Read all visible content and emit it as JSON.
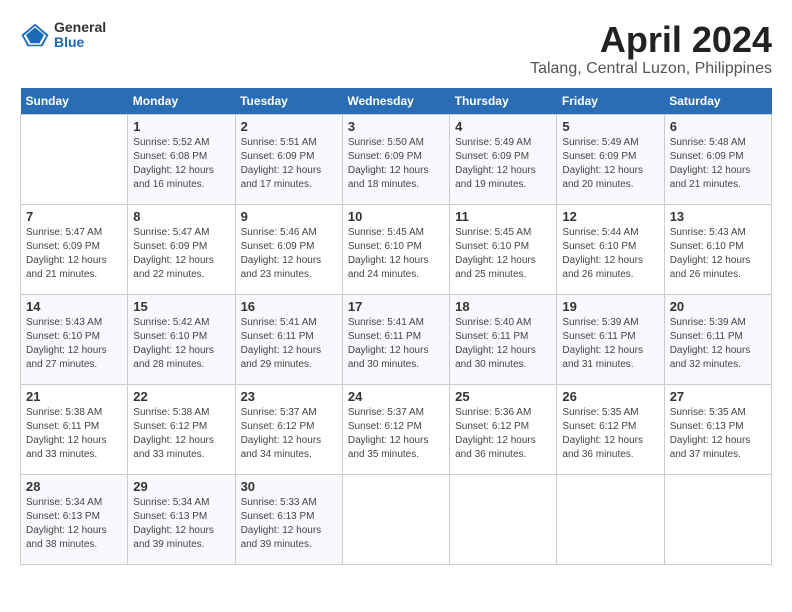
{
  "logo": {
    "general": "General",
    "blue": "Blue"
  },
  "title": "April 2024",
  "location": "Talang, Central Luzon, Philippines",
  "days_of_week": [
    "Sunday",
    "Monday",
    "Tuesday",
    "Wednesday",
    "Thursday",
    "Friday",
    "Saturday"
  ],
  "weeks": [
    [
      {
        "day": "",
        "info": ""
      },
      {
        "day": "1",
        "info": "Sunrise: 5:52 AM\nSunset: 6:08 PM\nDaylight: 12 hours\nand 16 minutes."
      },
      {
        "day": "2",
        "info": "Sunrise: 5:51 AM\nSunset: 6:09 PM\nDaylight: 12 hours\nand 17 minutes."
      },
      {
        "day": "3",
        "info": "Sunrise: 5:50 AM\nSunset: 6:09 PM\nDaylight: 12 hours\nand 18 minutes."
      },
      {
        "day": "4",
        "info": "Sunrise: 5:49 AM\nSunset: 6:09 PM\nDaylight: 12 hours\nand 19 minutes."
      },
      {
        "day": "5",
        "info": "Sunrise: 5:49 AM\nSunset: 6:09 PM\nDaylight: 12 hours\nand 20 minutes."
      },
      {
        "day": "6",
        "info": "Sunrise: 5:48 AM\nSunset: 6:09 PM\nDaylight: 12 hours\nand 21 minutes."
      }
    ],
    [
      {
        "day": "7",
        "info": "Sunrise: 5:47 AM\nSunset: 6:09 PM\nDaylight: 12 hours\nand 21 minutes."
      },
      {
        "day": "8",
        "info": "Sunrise: 5:47 AM\nSunset: 6:09 PM\nDaylight: 12 hours\nand 22 minutes."
      },
      {
        "day": "9",
        "info": "Sunrise: 5:46 AM\nSunset: 6:09 PM\nDaylight: 12 hours\nand 23 minutes."
      },
      {
        "day": "10",
        "info": "Sunrise: 5:45 AM\nSunset: 6:10 PM\nDaylight: 12 hours\nand 24 minutes."
      },
      {
        "day": "11",
        "info": "Sunrise: 5:45 AM\nSunset: 6:10 PM\nDaylight: 12 hours\nand 25 minutes."
      },
      {
        "day": "12",
        "info": "Sunrise: 5:44 AM\nSunset: 6:10 PM\nDaylight: 12 hours\nand 26 minutes."
      },
      {
        "day": "13",
        "info": "Sunrise: 5:43 AM\nSunset: 6:10 PM\nDaylight: 12 hours\nand 26 minutes."
      }
    ],
    [
      {
        "day": "14",
        "info": "Sunrise: 5:43 AM\nSunset: 6:10 PM\nDaylight: 12 hours\nand 27 minutes."
      },
      {
        "day": "15",
        "info": "Sunrise: 5:42 AM\nSunset: 6:10 PM\nDaylight: 12 hours\nand 28 minutes."
      },
      {
        "day": "16",
        "info": "Sunrise: 5:41 AM\nSunset: 6:11 PM\nDaylight: 12 hours\nand 29 minutes."
      },
      {
        "day": "17",
        "info": "Sunrise: 5:41 AM\nSunset: 6:11 PM\nDaylight: 12 hours\nand 30 minutes."
      },
      {
        "day": "18",
        "info": "Sunrise: 5:40 AM\nSunset: 6:11 PM\nDaylight: 12 hours\nand 30 minutes."
      },
      {
        "day": "19",
        "info": "Sunrise: 5:39 AM\nSunset: 6:11 PM\nDaylight: 12 hours\nand 31 minutes."
      },
      {
        "day": "20",
        "info": "Sunrise: 5:39 AM\nSunset: 6:11 PM\nDaylight: 12 hours\nand 32 minutes."
      }
    ],
    [
      {
        "day": "21",
        "info": "Sunrise: 5:38 AM\nSunset: 6:11 PM\nDaylight: 12 hours\nand 33 minutes."
      },
      {
        "day": "22",
        "info": "Sunrise: 5:38 AM\nSunset: 6:12 PM\nDaylight: 12 hours\nand 33 minutes."
      },
      {
        "day": "23",
        "info": "Sunrise: 5:37 AM\nSunset: 6:12 PM\nDaylight: 12 hours\nand 34 minutes."
      },
      {
        "day": "24",
        "info": "Sunrise: 5:37 AM\nSunset: 6:12 PM\nDaylight: 12 hours\nand 35 minutes."
      },
      {
        "day": "25",
        "info": "Sunrise: 5:36 AM\nSunset: 6:12 PM\nDaylight: 12 hours\nand 36 minutes."
      },
      {
        "day": "26",
        "info": "Sunrise: 5:35 AM\nSunset: 6:12 PM\nDaylight: 12 hours\nand 36 minutes."
      },
      {
        "day": "27",
        "info": "Sunrise: 5:35 AM\nSunset: 6:13 PM\nDaylight: 12 hours\nand 37 minutes."
      }
    ],
    [
      {
        "day": "28",
        "info": "Sunrise: 5:34 AM\nSunset: 6:13 PM\nDaylight: 12 hours\nand 38 minutes."
      },
      {
        "day": "29",
        "info": "Sunrise: 5:34 AM\nSunset: 6:13 PM\nDaylight: 12 hours\nand 39 minutes."
      },
      {
        "day": "30",
        "info": "Sunrise: 5:33 AM\nSunset: 6:13 PM\nDaylight: 12 hours\nand 39 minutes."
      },
      {
        "day": "",
        "info": ""
      },
      {
        "day": "",
        "info": ""
      },
      {
        "day": "",
        "info": ""
      },
      {
        "day": "",
        "info": ""
      }
    ]
  ]
}
